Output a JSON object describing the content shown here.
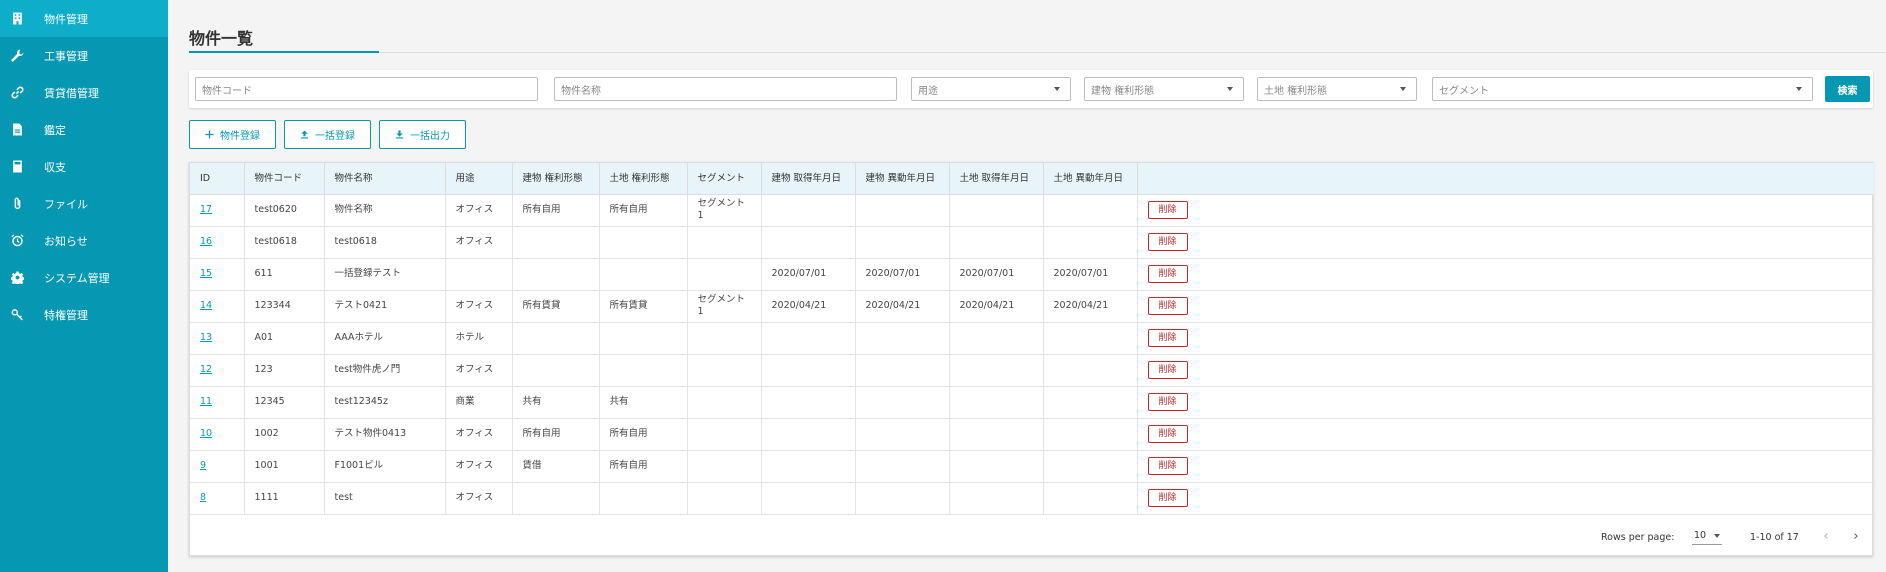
{
  "sidebar": {
    "items": [
      {
        "label": "物件管理",
        "icon": "building-icon",
        "active": true
      },
      {
        "label": "工事管理",
        "icon": "wrench-icon",
        "active": false
      },
      {
        "label": "賃貸借管理",
        "icon": "link-icon",
        "active": false
      },
      {
        "label": "鑑定",
        "icon": "document-icon",
        "active": false
      },
      {
        "label": "収支",
        "icon": "calculator-icon",
        "active": false
      },
      {
        "label": "ファイル",
        "icon": "paperclip-icon",
        "active": false
      },
      {
        "label": "お知らせ",
        "icon": "alarm-clock-icon",
        "active": false
      },
      {
        "label": "システム管理",
        "icon": "gear-icon",
        "active": false
      },
      {
        "label": "特権管理",
        "icon": "key-icon",
        "active": false
      }
    ]
  },
  "page": {
    "title": "物件一覧"
  },
  "filters": {
    "code_placeholder": "物件コード",
    "name_placeholder": "物件名称",
    "usage_label": "用途",
    "building_rights_label": "建物 権利形態",
    "land_rights_label": "土地 権利形態",
    "segment_label": "セグメント",
    "search_label": "検索"
  },
  "actions": {
    "register": "物件登録",
    "bulk_register": "一括登録",
    "bulk_export": "一括出力"
  },
  "table": {
    "headers": {
      "id": "ID",
      "code": "物件コード",
      "name": "物件名称",
      "usage": "用途",
      "building_rights": "建物 権利形態",
      "land_rights": "土地 権利形態",
      "segment": "セグメント",
      "building_acquired": "建物 取得年月日",
      "building_changed": "建物 異動年月日",
      "land_acquired": "土地 取得年月日",
      "land_changed": "土地 異動年月日"
    },
    "delete_label": "削除",
    "rows": [
      {
        "id": "17",
        "code": "test0620",
        "name": "物件名称",
        "usage": "オフィス",
        "b_rights": "所有自用",
        "l_rights": "所有自用",
        "segment": "セグメント1",
        "b_acq": "",
        "b_chg": "",
        "l_acq": "",
        "l_chg": ""
      },
      {
        "id": "16",
        "code": "test0618",
        "name": "test0618",
        "usage": "オフィス",
        "b_rights": "",
        "l_rights": "",
        "segment": "",
        "b_acq": "",
        "b_chg": "",
        "l_acq": "",
        "l_chg": ""
      },
      {
        "id": "15",
        "code": "611",
        "name": "一括登録テスト",
        "usage": "",
        "b_rights": "",
        "l_rights": "",
        "segment": "",
        "b_acq": "2020/07/01",
        "b_chg": "2020/07/01",
        "l_acq": "2020/07/01",
        "l_chg": "2020/07/01"
      },
      {
        "id": "14",
        "code": "123344",
        "name": "テスト0421",
        "usage": "オフィス",
        "b_rights": "所有賃貸",
        "l_rights": "所有賃貸",
        "segment": "セグメント1",
        "b_acq": "2020/04/21",
        "b_chg": "2020/04/21",
        "l_acq": "2020/04/21",
        "l_chg": "2020/04/21"
      },
      {
        "id": "13",
        "code": "A01",
        "name": "AAAホテル",
        "usage": "ホテル",
        "b_rights": "",
        "l_rights": "",
        "segment": "",
        "b_acq": "",
        "b_chg": "",
        "l_acq": "",
        "l_chg": ""
      },
      {
        "id": "12",
        "code": "123",
        "name": "test物件虎ノ門",
        "usage": "オフィス",
        "b_rights": "",
        "l_rights": "",
        "segment": "",
        "b_acq": "",
        "b_chg": "",
        "l_acq": "",
        "l_chg": ""
      },
      {
        "id": "11",
        "code": "12345",
        "name": "test12345z",
        "usage": "商業",
        "b_rights": "共有",
        "l_rights": "共有",
        "segment": "",
        "b_acq": "",
        "b_chg": "",
        "l_acq": "",
        "l_chg": ""
      },
      {
        "id": "10",
        "code": "1002",
        "name": "テスト物件0413",
        "usage": "オフィス",
        "b_rights": "所有自用",
        "l_rights": "所有自用",
        "segment": "",
        "b_acq": "",
        "b_chg": "",
        "l_acq": "",
        "l_chg": ""
      },
      {
        "id": "9",
        "code": "1001",
        "name": "F1001ビル",
        "usage": "オフィス",
        "b_rights": "賃借",
        "l_rights": "所有自用",
        "segment": "",
        "b_acq": "",
        "b_chg": "",
        "l_acq": "",
        "l_chg": ""
      },
      {
        "id": "8",
        "code": "1111",
        "name": "test",
        "usage": "オフィス",
        "b_rights": "",
        "l_rights": "",
        "segment": "",
        "b_acq": "",
        "b_chg": "",
        "l_acq": "",
        "l_chg": ""
      }
    ]
  },
  "pagination": {
    "rows_per_page_label": "Rows per page:",
    "rows_per_page_value": "10",
    "range_label": "1-10 of 17",
    "prev": "‹",
    "next": "›"
  },
  "colors": {
    "sidebar": "#0698b2",
    "sidebar_active": "#0eaecb",
    "accent": "#0698b2",
    "danger": "#c62828",
    "table_header": "#e7f4f9"
  }
}
